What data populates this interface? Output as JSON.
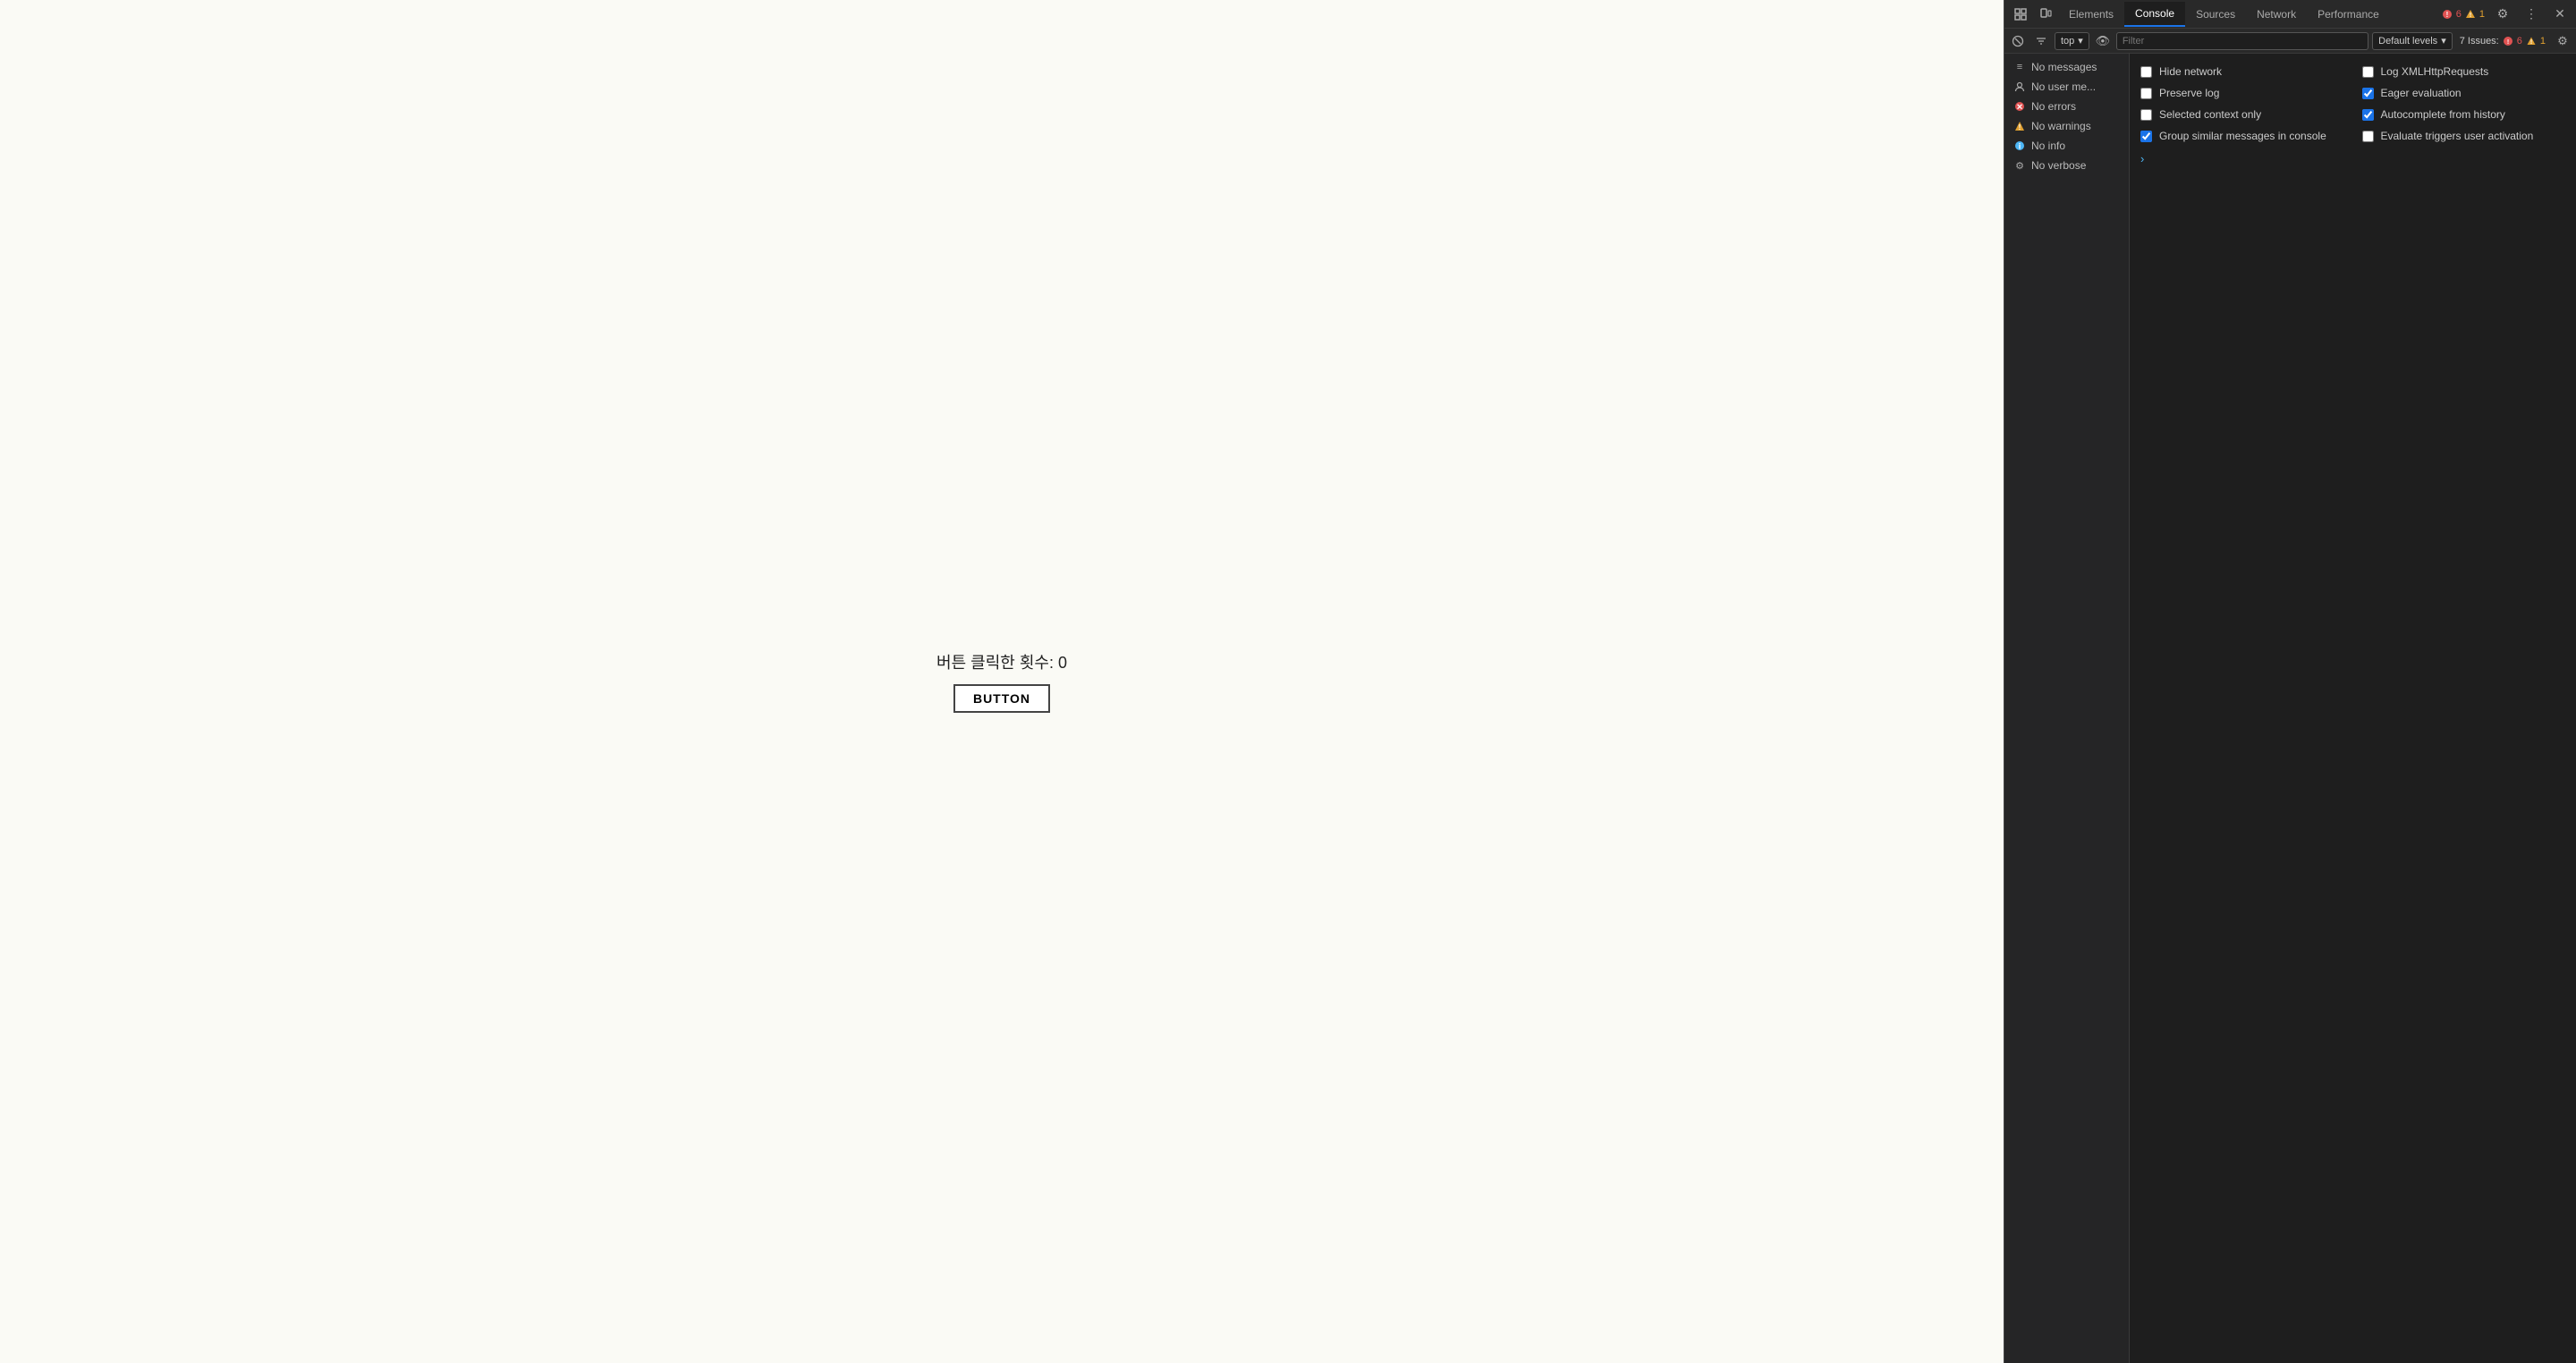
{
  "page": {
    "click_counter_label": "버튼 클릭한 횟수: 0",
    "button_label": "BUTTON"
  },
  "devtools": {
    "tabs": [
      {
        "id": "elements",
        "label": "Elements",
        "active": false
      },
      {
        "id": "console",
        "label": "Console",
        "active": true
      },
      {
        "id": "sources",
        "label": "Sources",
        "active": false
      },
      {
        "id": "network",
        "label": "Network",
        "active": false
      },
      {
        "id": "performance",
        "label": "Performance",
        "active": false
      }
    ],
    "issues_label": "7 Issues:",
    "issues_errors": "6",
    "issues_warnings": "1",
    "toolbar": {
      "context_label": "top",
      "filter_placeholder": "Filter",
      "levels_label": "Default levels"
    },
    "filter_items": [
      {
        "id": "messages",
        "icon": "≡",
        "icon_class": "icon-list",
        "label": "No messages"
      },
      {
        "id": "user-messages",
        "icon": "👤",
        "icon_class": "icon-user",
        "label": "No user me..."
      },
      {
        "id": "errors",
        "icon": "✖",
        "icon_class": "icon-error",
        "label": "No errors"
      },
      {
        "id": "warnings",
        "icon": "⚠",
        "icon_class": "icon-warning",
        "label": "No warnings"
      },
      {
        "id": "info",
        "icon": "ℹ",
        "icon_class": "icon-info",
        "label": "No info"
      },
      {
        "id": "verbose",
        "icon": "⚙",
        "icon_class": "icon-verbose",
        "label": "No verbose"
      }
    ],
    "settings": [
      {
        "id": "hide-network",
        "label": "Hide network",
        "checked": false,
        "col": 0
      },
      {
        "id": "log-xmlhttp",
        "label": "Log XMLHttpRequests",
        "checked": false,
        "col": 1
      },
      {
        "id": "preserve-log",
        "label": "Preserve log",
        "checked": false,
        "col": 0
      },
      {
        "id": "eager-eval",
        "label": "Eager evaluation",
        "checked": true,
        "col": 1
      },
      {
        "id": "selected-context",
        "label": "Selected context only",
        "checked": false,
        "col": 0
      },
      {
        "id": "autocomplete-history",
        "label": "Autocomplete from history",
        "checked": true,
        "col": 1
      },
      {
        "id": "group-similar",
        "label": "Group similar messages in console",
        "checked": true,
        "col": 0
      },
      {
        "id": "eval-triggers",
        "label": "Evaluate triggers user activation",
        "checked": false,
        "col": 1
      }
    ]
  }
}
